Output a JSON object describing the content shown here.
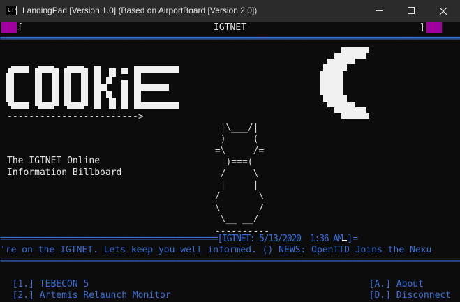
{
  "window": {
    "title": "LandingPad [Version 1.0] (Based on AirportBoard [Version 2.0])",
    "icon": "console-icon"
  },
  "header": {
    "bracket_left": "[",
    "title": "IGTNET",
    "bracket_right": "]"
  },
  "rules": {
    "top": "=====================================================================================================",
    "status_prefix": "===============================================[IGTNET: 5/13/2020  1:36 AM",
    "status_suffix": "]=",
    "bottom": "====================================================================================================="
  },
  "logo": {
    "text": "COOKiE",
    "underline_arrow": "------------------------>",
    "moon": "crescent-moon-icon"
  },
  "description": {
    "line1": "The IGTNET Online",
    "line2": "Information Billboard"
  },
  "cat_art": "  |\\___/|\n  )     (\n =\\     /=\n   )===(\n  /     \\\n  |     |\n /       \\\n \\       /\n  \\__ __/\n ----------",
  "ticker": "'re on the IGTNET. Lets keep you well informed. () NEWS: OpenTTD Joins the Nexu",
  "menu_left": [
    {
      "key": "[1.]",
      "label": "TEBECON 5"
    },
    {
      "key": "[2.]",
      "label": "Artemis Relaunch Monitor"
    }
  ],
  "menu_right": [
    {
      "key": "[A.]",
      "label": "About"
    },
    {
      "key": "[D.]",
      "label": "Disconnect"
    }
  ],
  "colors": {
    "background": "#0c0c0c",
    "accent_blue": "#3a6fd8",
    "magenta": "#a000a0",
    "text": "#e6e6e6"
  }
}
